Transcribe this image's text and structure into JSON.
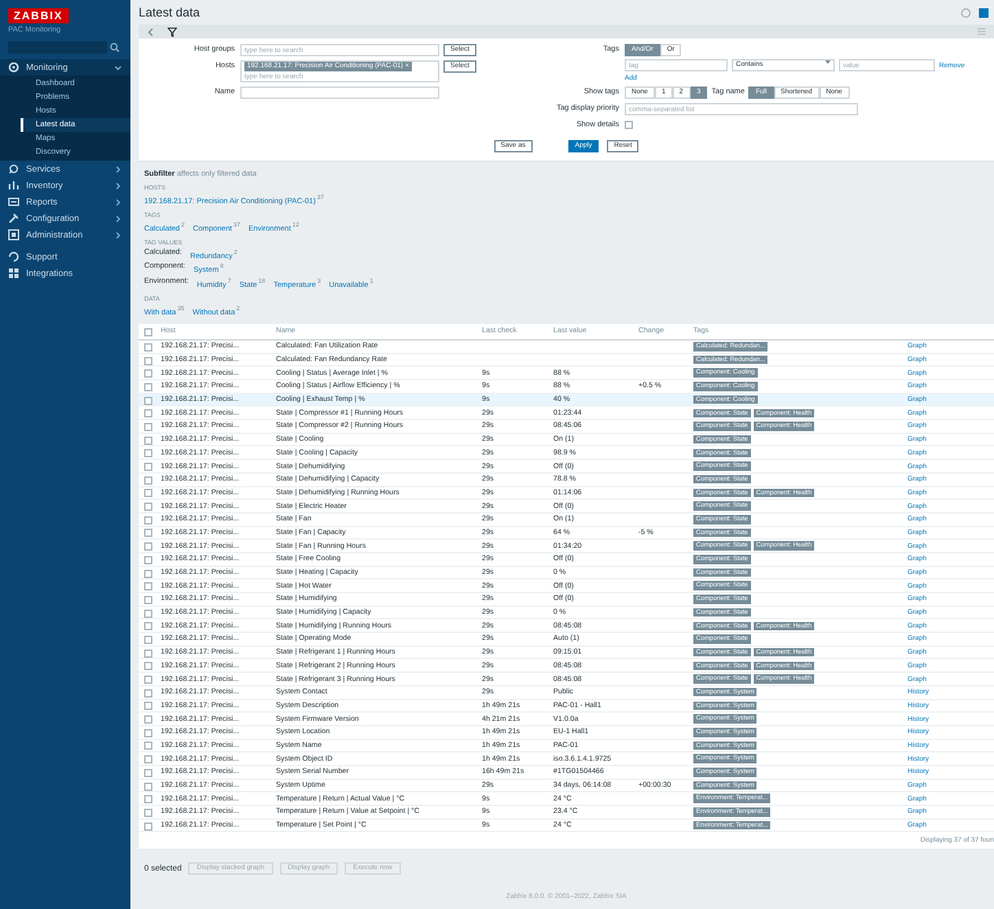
{
  "sidebar": {
    "logo": "ZABBIX",
    "server_name": "PAC Monitoring",
    "menu": [
      {
        "label": "Monitoring",
        "expanded": true,
        "children": [
          {
            "label": "Dashboard",
            "selected": false
          },
          {
            "label": "Problems",
            "selected": false
          },
          {
            "label": "Hosts",
            "selected": false
          },
          {
            "label": "Latest data",
            "selected": true
          },
          {
            "label": "Maps",
            "selected": false
          },
          {
            "label": "Discovery",
            "selected": false
          }
        ]
      },
      {
        "label": "Services",
        "expanded": false
      },
      {
        "label": "Inventory",
        "expanded": false
      },
      {
        "label": "Reports",
        "expanded": false
      },
      {
        "label": "Configuration",
        "expanded": false
      },
      {
        "label": "Administration",
        "expanded": false
      },
      {
        "label": "Support"
      },
      {
        "label": "Integrations"
      }
    ]
  },
  "header": {
    "title": "Latest data"
  },
  "filter": {
    "host_groups": {
      "label": "Host groups",
      "placeholder": "type here to search",
      "button": "Select"
    },
    "hosts": {
      "label": "Hosts",
      "chips": [
        {
          "label": "192.168.21.17: Precision Air Conditioning (PAC-01)",
          "remove": "×"
        }
      ],
      "placeholder": "type here to search",
      "button": "Select"
    },
    "name": {
      "label": "Name"
    },
    "tags": {
      "label": "Tags",
      "operators": [
        {
          "label": "And/Or",
          "selected": true
        },
        {
          "label": "Or",
          "selected": false
        }
      ],
      "rows": [
        {
          "tag_placeholder": "tag",
          "operator": "Contains",
          "value_placeholder": "value",
          "remove": "Remove"
        }
      ],
      "add": "Add"
    },
    "show_tags": {
      "label": "Show tags",
      "options": [
        {
          "label": "None",
          "selected": false
        },
        {
          "label": "1",
          "selected": false
        },
        {
          "label": "2",
          "selected": false
        },
        {
          "label": "3",
          "selected": true
        }
      ]
    },
    "tag_name": {
      "label": "Tag name",
      "options": [
        {
          "label": "Full",
          "selected": true
        },
        {
          "label": "Shortened",
          "selected": false
        },
        {
          "label": "None",
          "selected": false
        }
      ]
    },
    "tag_priority": {
      "label": "Tag display priority",
      "placeholder": "comma-separated list"
    },
    "show_details": {
      "label": "Show details",
      "checked": false
    },
    "buttons": {
      "save": "Save as",
      "apply": "Apply",
      "reset": "Reset"
    }
  },
  "subfilter": {
    "title": "Subfilter",
    "note": "affects only filtered data",
    "groups": [
      {
        "label": "HOSTS",
        "lines": [
          [
            {
              "name": "192.168.21.17: Precision Air Conditioning (PAC-01)",
              "count": "37"
            }
          ]
        ]
      },
      {
        "label": "TAGS",
        "lines": [
          [
            {
              "name": "Calculated",
              "count": "2"
            },
            {
              "name": "Component",
              "count": "37"
            },
            {
              "name": "Environment",
              "count": "12"
            }
          ]
        ]
      },
      {
        "label": "TAG VALUES",
        "lines": [
          [
            {
              "name": "Calculated:"
            },
            {
              "name": "Redundancy",
              "count": "2"
            }
          ],
          [
            {
              "name": "Component:"
            },
            {
              "name": "System",
              "count": "8"
            }
          ],
          [
            {
              "name": "Environment:"
            },
            {
              "name": "Humidity",
              "count": "7"
            },
            {
              "name": "State",
              "count": "18"
            },
            {
              "name": "Temperature",
              "count": "3"
            },
            {
              "name": "Unavailable",
              "count": "1"
            }
          ]
        ]
      },
      {
        "label": "DATA",
        "lines": [
          [
            {
              "name": "With data",
              "count": "35"
            },
            {
              "name": "Without data",
              "count": "2"
            }
          ]
        ]
      }
    ]
  },
  "table": {
    "select_all_checked": false,
    "columns": [
      "Host",
      "Name",
      "Last check",
      "Last value",
      "Change",
      "Tags"
    ],
    "rows": [
      {
        "host": "192.168.21.17: Precisi...",
        "name": "Calculated: Fan Utilization Rate",
        "last_check": "",
        "last_value": "",
        "change": "",
        "tags": [
          "Calculated: Redundan..."
        ],
        "info": "Graph",
        "checked": false,
        "highlighted": false
      },
      {
        "host": "192.168.21.17: Precisi...",
        "name": "Calculated: Fan Redundancy Rate",
        "last_check": "",
        "last_value": "",
        "change": "",
        "tags": [
          "Calculated: Redundan..."
        ],
        "info": "Graph",
        "checked": false,
        "highlighted": false
      },
      {
        "host": "192.168.21.17: Precisi...",
        "name": "Cooling | Status | Average Inlet | %",
        "last_check": "9s",
        "last_value": "88 %",
        "change": "",
        "tags": [
          "Component: Cooling"
        ],
        "info": "Graph",
        "checked": false,
        "highlighted": false
      },
      {
        "host": "192.168.21.17: Precisi...",
        "name": "Cooling | Status | Airflow Efficiency | %",
        "last_check": "9s",
        "last_value": "88 %",
        "change": "+0.5 %",
        "tags": [
          "Component: Cooling"
        ],
        "info": "Graph",
        "checked": false,
        "highlighted": false
      },
      {
        "host": "192.168.21.17: Precisi...",
        "name": "Cooling | Exhaust Temp | %",
        "last_check": "9s",
        "last_value": "40 %",
        "change": "",
        "tags": [
          "Component: Cooling"
        ],
        "info": "Graph",
        "checked": false,
        "highlighted": true
      },
      {
        "host": "192.168.21.17: Precisi...",
        "name": "State | Compressor #1 | Running Hours",
        "last_check": "29s",
        "last_value": "01:23:44",
        "change": "",
        "tags": [
          "Component: State",
          "Component: Health"
        ],
        "info": "Graph",
        "checked": false,
        "highlighted": false
      },
      {
        "host": "192.168.21.17: Precisi...",
        "name": "State | Compressor #2 | Running Hours",
        "last_check": "29s",
        "last_value": "08:45:06",
        "change": "",
        "tags": [
          "Component: State",
          "Component: Health"
        ],
        "info": "Graph",
        "checked": false,
        "highlighted": false
      },
      {
        "host": "192.168.21.17: Precisi...",
        "name": "State | Cooling",
        "last_check": "29s",
        "last_value": "On (1)",
        "change": "",
        "tags": [
          "Component: State"
        ],
        "info": "Graph",
        "checked": false,
        "highlighted": false
      },
      {
        "host": "192.168.21.17: Precisi...",
        "name": "State | Cooling | Capacity",
        "last_check": "29s",
        "last_value": "98.9 %",
        "change": "",
        "tags": [
          "Component: State"
        ],
        "info": "Graph",
        "checked": false,
        "highlighted": false
      },
      {
        "host": "192.168.21.17: Precisi...",
        "name": "State | Dehumidifying",
        "last_check": "29s",
        "last_value": "Off (0)",
        "change": "",
        "tags": [
          "Component: State"
        ],
        "info": "Graph",
        "checked": false,
        "highlighted": false
      },
      {
        "host": "192.168.21.17: Precisi...",
        "name": "State | Dehumidifying | Capacity",
        "last_check": "29s",
        "last_value": "78.8 %",
        "change": "",
        "tags": [
          "Component: State"
        ],
        "info": "Graph",
        "checked": false,
        "highlighted": false
      },
      {
        "host": "192.168.21.17: Precisi...",
        "name": "State | Dehumidifying | Running Hours",
        "last_check": "29s",
        "last_value": "01:14:06",
        "change": "",
        "tags": [
          "Component: State",
          "Component: Health"
        ],
        "info": "Graph",
        "checked": false,
        "highlighted": false
      },
      {
        "host": "192.168.21.17: Precisi...",
        "name": "State | Electric Heater",
        "last_check": "29s",
        "last_value": "Off (0)",
        "change": "",
        "tags": [
          "Component: State"
        ],
        "info": "Graph",
        "checked": false,
        "highlighted": false
      },
      {
        "host": "192.168.21.17: Precisi...",
        "name": "State | Fan",
        "last_check": "29s",
        "last_value": "On (1)",
        "change": "",
        "tags": [
          "Component: State"
        ],
        "info": "Graph",
        "checked": false,
        "highlighted": false
      },
      {
        "host": "192.168.21.17: Precisi...",
        "name": "State | Fan | Capacity",
        "last_check": "29s",
        "last_value": "64 %",
        "change": "-5 %",
        "tags": [
          "Component: State"
        ],
        "info": "Graph",
        "checked": false,
        "highlighted": false
      },
      {
        "host": "192.168.21.17: Precisi...",
        "name": "State | Fan | Running Hours",
        "last_check": "29s",
        "last_value": "01:34:20",
        "change": "",
        "tags": [
          "Component: State",
          "Component: Health"
        ],
        "info": "Graph",
        "checked": false,
        "highlighted": false
      },
      {
        "host": "192.168.21.17: Precisi...",
        "name": "State | Free Cooling",
        "last_check": "29s",
        "last_value": "Off (0)",
        "change": "",
        "tags": [
          "Component: State"
        ],
        "info": "Graph",
        "checked": false,
        "highlighted": false
      },
      {
        "host": "192.168.21.17: Precisi...",
        "name": "State | Heating | Capacity",
        "last_check": "29s",
        "last_value": "0 %",
        "change": "",
        "tags": [
          "Component: State"
        ],
        "info": "Graph",
        "checked": false,
        "highlighted": false
      },
      {
        "host": "192.168.21.17: Precisi...",
        "name": "State | Hot Water",
        "last_check": "29s",
        "last_value": "Off (0)",
        "change": "",
        "tags": [
          "Component: State"
        ],
        "info": "Graph",
        "checked": false,
        "highlighted": false
      },
      {
        "host": "192.168.21.17: Precisi...",
        "name": "State | Humidifying",
        "last_check": "29s",
        "last_value": "Off (0)",
        "change": "",
        "tags": [
          "Component: State"
        ],
        "info": "Graph",
        "checked": false,
        "highlighted": false
      },
      {
        "host": "192.168.21.17: Precisi...",
        "name": "State | Humidifying | Capacity",
        "last_check": "29s",
        "last_value": "0 %",
        "change": "",
        "tags": [
          "Component: State"
        ],
        "info": "Graph",
        "checked": false,
        "highlighted": false
      },
      {
        "host": "192.168.21.17: Precisi...",
        "name": "State | Humidifying | Running Hours",
        "last_check": "29s",
        "last_value": "08:45:08",
        "change": "",
        "tags": [
          "Component: State",
          "Component: Health"
        ],
        "info": "Graph",
        "checked": false,
        "highlighted": false
      },
      {
        "host": "192.168.21.17: Precisi...",
        "name": "State | Operating Mode",
        "last_check": "29s",
        "last_value": "Auto (1)",
        "change": "",
        "tags": [
          "Component: State"
        ],
        "info": "Graph",
        "checked": false,
        "highlighted": false
      },
      {
        "host": "192.168.21.17: Precisi...",
        "name": "State | Refrigerant 1 | Running Hours",
        "last_check": "29s",
        "last_value": "09:15:01",
        "change": "",
        "tags": [
          "Component: State",
          "Component: Health"
        ],
        "info": "Graph",
        "checked": false,
        "highlighted": false
      },
      {
        "host": "192.168.21.17: Precisi...",
        "name": "State | Refrigerant 2 | Running Hours",
        "last_check": "29s",
        "last_value": "08:45:08",
        "change": "",
        "tags": [
          "Component: State",
          "Component: Health"
        ],
        "info": "Graph",
        "checked": false,
        "highlighted": false
      },
      {
        "host": "192.168.21.17: Precisi...",
        "name": "State | Refrigerant 3 | Running Hours",
        "last_check": "29s",
        "last_value": "08:45:08",
        "change": "",
        "tags": [
          "Component: State",
          "Component: Health"
        ],
        "info": "Graph",
        "checked": false,
        "highlighted": false
      },
      {
        "host": "192.168.21.17: Precisi...",
        "name": "System Contact",
        "last_check": "29s",
        "last_value": "Public",
        "change": "",
        "tags": [
          "Component: System"
        ],
        "info": "History",
        "checked": false,
        "highlighted": false
      },
      {
        "host": "192.168.21.17: Precisi...",
        "name": "System Description",
        "last_check": "1h 49m 21s",
        "last_value": "PAC-01 - Hall1",
        "change": "",
        "tags": [
          "Component: System"
        ],
        "info": "History",
        "checked": false,
        "highlighted": false
      },
      {
        "host": "192.168.21.17: Precisi...",
        "name": "System Firmware Version",
        "last_check": "4h 21m 21s",
        "last_value": "V1.0.0a",
        "change": "",
        "tags": [
          "Component: System"
        ],
        "info": "History",
        "checked": false,
        "highlighted": false
      },
      {
        "host": "192.168.21.17: Precisi...",
        "name": "System Location",
        "last_check": "1h 49m 21s",
        "last_value": "EU-1 Hall1",
        "change": "",
        "tags": [
          "Component: System"
        ],
        "info": "History",
        "checked": false,
        "highlighted": false
      },
      {
        "host": "192.168.21.17: Precisi...",
        "name": "System Name",
        "last_check": "1h 49m 21s",
        "last_value": "PAC-01",
        "change": "",
        "tags": [
          "Component: System"
        ],
        "info": "History",
        "checked": false,
        "highlighted": false
      },
      {
        "host": "192.168.21.17: Precisi...",
        "name": "System Object ID",
        "last_check": "1h 49m 21s",
        "last_value": "iso.3.6.1.4.1.9725",
        "change": "",
        "tags": [
          "Component: System"
        ],
        "info": "History",
        "checked": false,
        "highlighted": false
      },
      {
        "host": "192.168.21.17: Precisi...",
        "name": "System Serial Number",
        "last_check": "16h 49m 21s",
        "last_value": "#1TG01504466",
        "change": "",
        "tags": [
          "Component: System"
        ],
        "info": "History",
        "checked": false,
        "highlighted": false
      },
      {
        "host": "192.168.21.17: Precisi...",
        "name": "System Uptime",
        "last_check": "29s",
        "last_value": "34 days, 06:14:08",
        "change": "+00:00:30",
        "tags": [
          "Component: System"
        ],
        "info": "Graph",
        "checked": false,
        "highlighted": false
      },
      {
        "host": "192.168.21.17: Precisi...",
        "name": "Temperature | Return | Actual Value | °C",
        "last_check": "9s",
        "last_value": "24 °C",
        "change": "",
        "tags": [
          "Environment: Temperat..."
        ],
        "info": "Graph",
        "checked": false,
        "highlighted": false
      },
      {
        "host": "192.168.21.17: Precisi...",
        "name": "Temperature | Return | Value at Setpoint | °C",
        "last_check": "9s",
        "last_value": "23.4 °C",
        "change": "",
        "tags": [
          "Environment: Temperat..."
        ],
        "info": "Graph",
        "checked": false,
        "highlighted": false
      },
      {
        "host": "192.168.21.17: Precisi...",
        "name": "Temperature | Set Point | °C",
        "last_check": "9s",
        "last_value": "24 °C",
        "change": "",
        "tags": [
          "Environment: Temperat..."
        ],
        "info": "Graph",
        "checked": false,
        "highlighted": false
      }
    ],
    "summary": "Displaying 37 of 37 foun"
  },
  "actions": {
    "selected": "0 selected",
    "buttons": [
      "Display stacked graph",
      "Display graph",
      "Execute now"
    ]
  },
  "copyright": "Zabbix 6.0.0. © 2001–2022, Zabbix SIA"
}
